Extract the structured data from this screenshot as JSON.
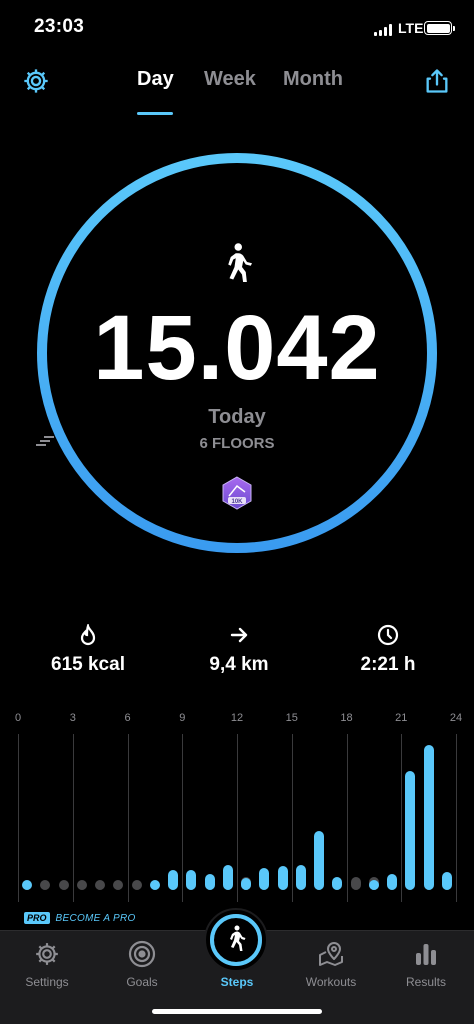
{
  "status": {
    "time": "23:03",
    "network": "LTE"
  },
  "header": {
    "tabs": [
      {
        "label": "Day",
        "active": true
      },
      {
        "label": "Week",
        "active": false
      },
      {
        "label": "Month",
        "active": false
      }
    ],
    "settings_icon": "gear-icon",
    "share_icon": "share-icon"
  },
  "summary": {
    "steps": "15.042",
    "period": "Today",
    "floors": "6 FLOORS",
    "badge": "10K",
    "goal_progress": 1.0
  },
  "stats": [
    {
      "icon": "flame-icon",
      "value": "615 kcal"
    },
    {
      "icon": "arrow-right-icon",
      "value": "9,4 km"
    },
    {
      "icon": "clock-icon",
      "value": "2:21 h"
    }
  ],
  "chart_data": {
    "type": "bar",
    "x_ticks": [
      "0",
      "3",
      "6",
      "9",
      "12",
      "15",
      "18",
      "21",
      "24"
    ],
    "series": [
      {
        "values": [
          150,
          0,
          0,
          0,
          0,
          0,
          0,
          150,
          300,
          300,
          250,
          380,
          180,
          330,
          370,
          380,
          900,
          200,
          0,
          150,
          250,
          1800,
          2200,
          280
        ]
      },
      {
        "values": [
          0,
          140,
          140,
          140,
          140,
          140,
          140,
          0,
          0,
          0,
          0,
          0,
          200,
          0,
          0,
          0,
          0,
          0,
          200,
          200,
          0,
          0,
          0,
          0
        ]
      }
    ],
    "colors": {
      "active": "#5ac8fa",
      "inactive": "#48484a"
    }
  },
  "promo": {
    "badge": "PRO",
    "text": "BECOME A PRO"
  },
  "tabbar": [
    {
      "label": "Settings",
      "icon": "gear-icon",
      "active": false
    },
    {
      "label": "Goals",
      "icon": "target-icon",
      "active": false
    },
    {
      "label": "Steps",
      "icon": "walker-icon",
      "active": true
    },
    {
      "label": "Workouts",
      "icon": "map-pin-icon",
      "active": false
    },
    {
      "label": "Results",
      "icon": "bar-chart-icon",
      "active": false
    }
  ],
  "accent": "#5ac8fa"
}
